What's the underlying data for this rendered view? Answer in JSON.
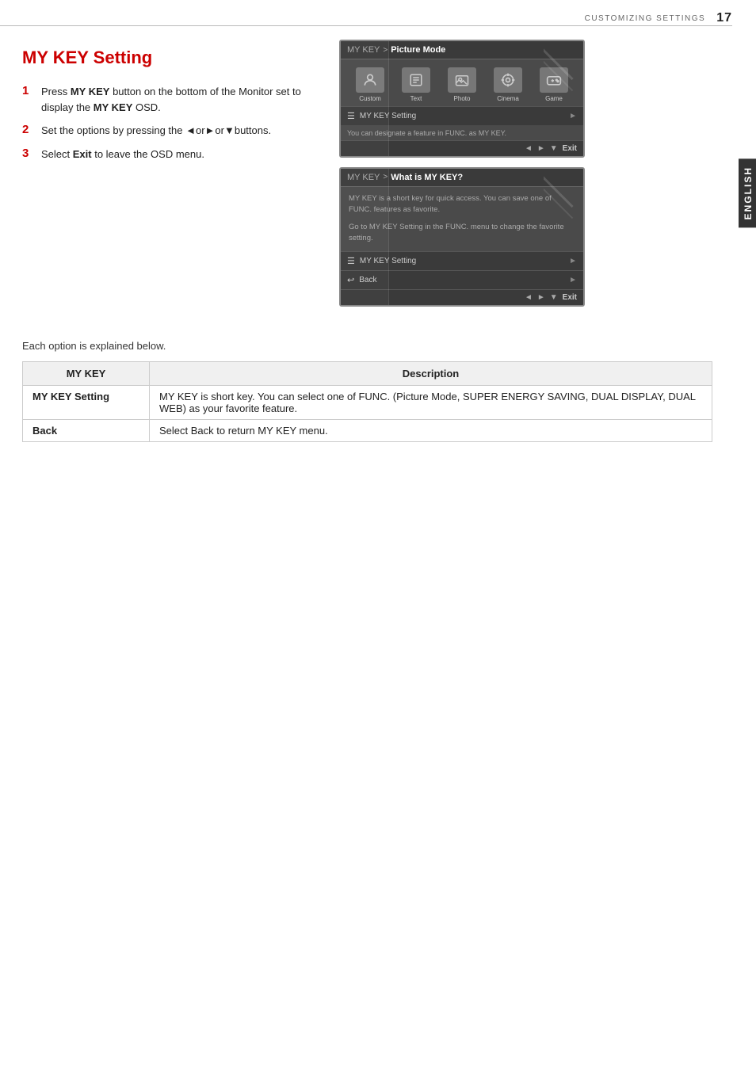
{
  "page": {
    "header": {
      "section": "CUSTOMIZING SETTINGS",
      "page_number": "17"
    },
    "side_tab": "ENGLISH",
    "title": "MY KEY Setting",
    "steps": [
      {
        "number": "1",
        "text": "Press ",
        "bold1": "MY KEY",
        "text2": " button on the bottom of the Monitor set to display the ",
        "bold2": "MY KEY",
        "text3": " OSD."
      },
      {
        "number": "2",
        "text": "Set the options by pressing the ◄or►or▼buttons."
      },
      {
        "number": "3",
        "text": "Select ",
        "bold": "Exit",
        "text2": " to leave the OSD menu."
      }
    ],
    "osd1": {
      "header_mykey": "MY KEY",
      "header_arrow": ">",
      "header_title": "Picture Mode",
      "icons": [
        {
          "label": "Custom",
          "symbol": "👤"
        },
        {
          "label": "Text",
          "symbol": "📄"
        },
        {
          "label": "Photo",
          "symbol": "🖼"
        },
        {
          "label": "Cinema",
          "symbol": "⚙"
        },
        {
          "label": "Game",
          "symbol": "🎮"
        }
      ],
      "menu_item": "MY KEY Setting",
      "menu_item_icon": "☰",
      "info_text": "You can designate a feature in FUNC. as MY KEY.",
      "nav": {
        "left": "◄",
        "right": "►",
        "down": "▼",
        "exit": "Exit"
      }
    },
    "osd2": {
      "header_mykey": "MY KEY",
      "header_arrow": ">",
      "header_title": "What is MY KEY?",
      "body1": "MY KEY is a short key for quick access. You can save one of FUNC. features as favorite.",
      "body2": "Go to MY KEY Setting in the FUNC. menu to change the favorite setting.",
      "menu_item1_icon": "☰",
      "menu_item1": "MY KEY Setting",
      "menu_item2_icon": "↩",
      "menu_item2": "Back",
      "nav": {
        "left": "◄",
        "right": "►",
        "down": "▼",
        "exit": "Exit"
      }
    },
    "each_option_text": "Each option is explained below.",
    "table": {
      "headers": [
        "MY KEY",
        "Description"
      ],
      "rows": [
        {
          "key": "MY KEY Setting",
          "description": "MY KEY is short key. You can select one of FUNC. (Picture Mode, SUPER ENERGY SAVING, DUAL DISPLAY, DUAL WEB) as your favorite feature."
        },
        {
          "key": "Back",
          "description": "Select Back to return MY KEY menu."
        }
      ]
    }
  }
}
